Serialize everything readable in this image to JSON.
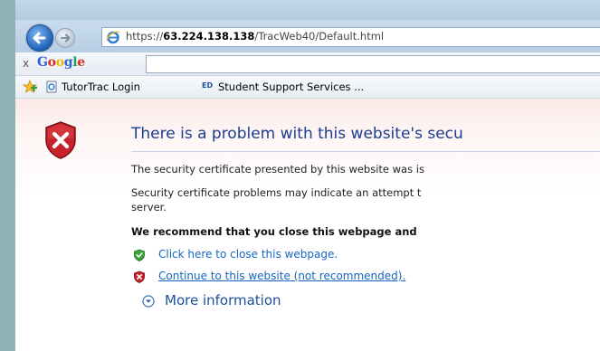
{
  "browser": {
    "url_prefix": "https://",
    "url_host": "63.224.138.138",
    "url_path": "/TracWeb40/Default.html",
    "google_logo": "Google",
    "google_close": "x"
  },
  "favorites": {
    "items": [
      {
        "label": "TutorTrac Login"
      },
      {
        "label": "Student Support Services ..."
      }
    ]
  },
  "page": {
    "title": "There is a problem with this website's secu",
    "para1": "The security certificate presented by this website was is",
    "para2_line1": "Security certificate problems may indicate an attempt t",
    "para2_line2": "server.",
    "recommend": "We recommend that you close this webpage and",
    "close_link": "Click here to close this webpage.",
    "continue_link": "Continue to this website (not recommended).",
    "more_info": "More information"
  },
  "colors": {
    "title": "#1b3d8f",
    "link": "#1565c0",
    "shield_red": "#c8232c",
    "ok_green": "#3aa33a"
  }
}
